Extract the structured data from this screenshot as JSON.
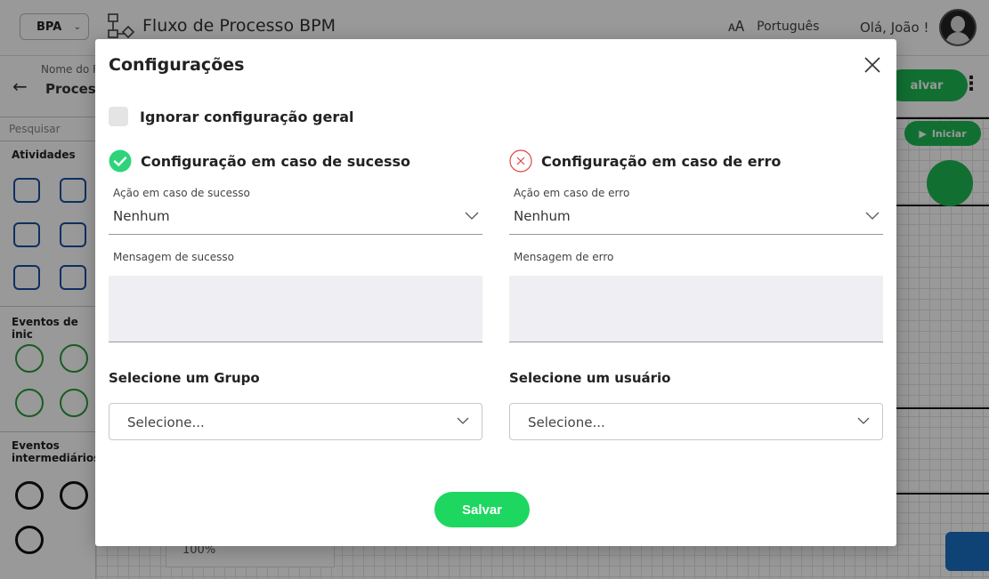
{
  "app": {
    "workspace_select": "BPA",
    "title": "Fluxo de Processo BPM",
    "language": "Português",
    "greeting": "Olá, João !",
    "process_name_label": "Nome do F",
    "process_name_value": "Process",
    "save_label": "alvar",
    "start_label": "Iniciar",
    "zoom": "100%"
  },
  "sidebar": {
    "search_placeholder": "Pesquisar",
    "sections": [
      "Atividades",
      "Eventos de inic",
      "Eventos intermediários"
    ]
  },
  "modal": {
    "title": "Configurações",
    "ignore_label": "Ignorar configuração geral",
    "success": {
      "title": "Configuração em caso de sucesso",
      "action_label": "Ação em caso de sucesso",
      "action_value": "Nenhum",
      "message_label": "Mensagem de sucesso",
      "group_label": "Selecione um Grupo",
      "group_placeholder": "Selecione..."
    },
    "error": {
      "title": "Configuração em caso de erro",
      "action_label": "Ação em caso de erro",
      "action_value": "Nenhum",
      "message_label": "Mensagem de erro",
      "user_label": "Selecione um usuário",
      "user_placeholder": "Selecione..."
    },
    "save_label": "Salvar"
  },
  "colors": {
    "success_green": "#1ed760",
    "error_red": "#e04646",
    "overlay": "rgba(0,0,0,0.4)"
  }
}
